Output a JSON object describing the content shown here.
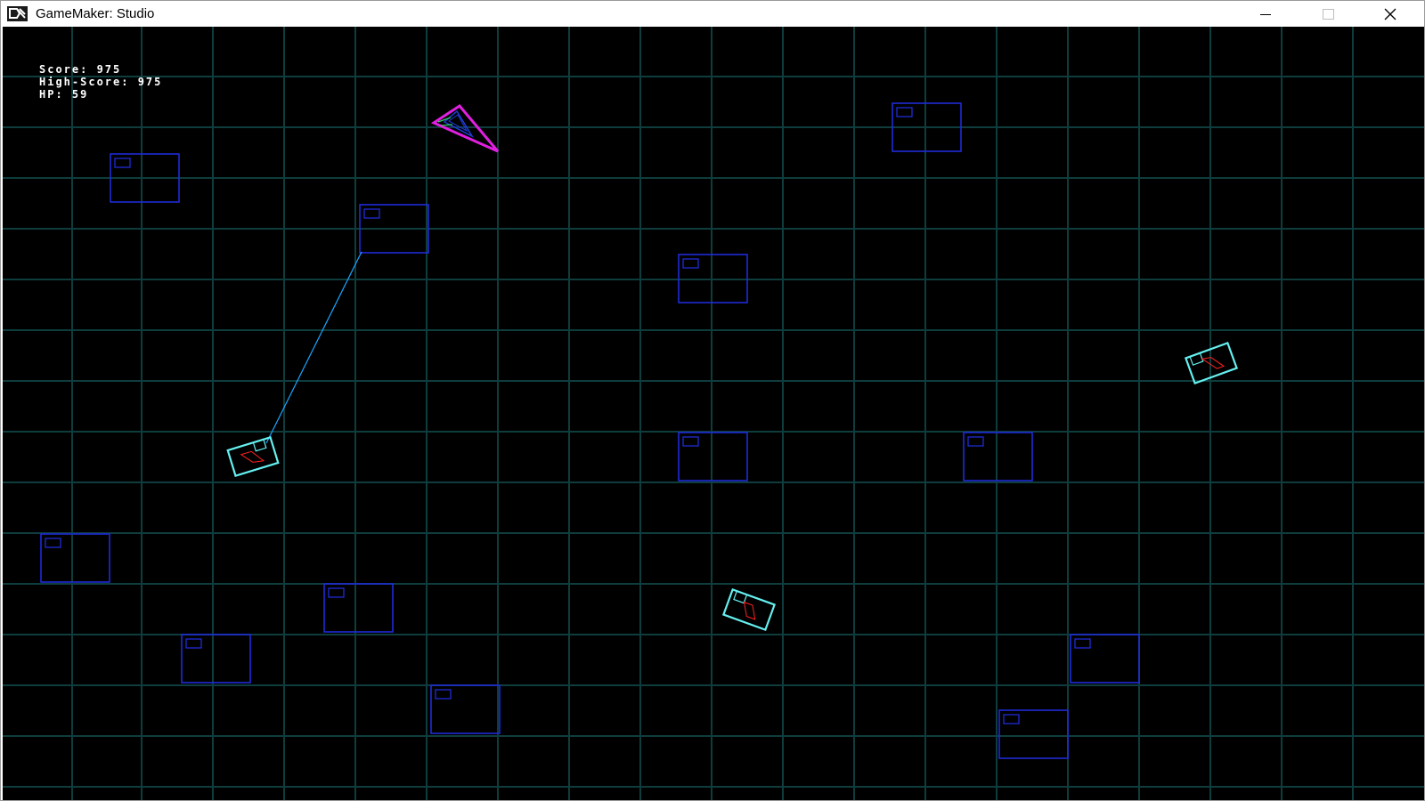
{
  "window": {
    "title": "GameMaker: Studio",
    "icon": "gamemaker-logo-icon",
    "controls": [
      "minimize-icon",
      "maximize-icon",
      "close-icon"
    ]
  },
  "hud": {
    "score": "Score: 975",
    "high_score": "High-Score: 975",
    "hp": "HP: 59"
  },
  "colors": {
    "background": "#000000",
    "grid": "#0f3d3d",
    "block": "#1f2bd6",
    "player": "#e020e0",
    "player_core": "#1f3bd6",
    "enemy_body": "#66f0f0",
    "enemy_detail": "#ff2020",
    "tether": "#1aa7ff"
  }
}
